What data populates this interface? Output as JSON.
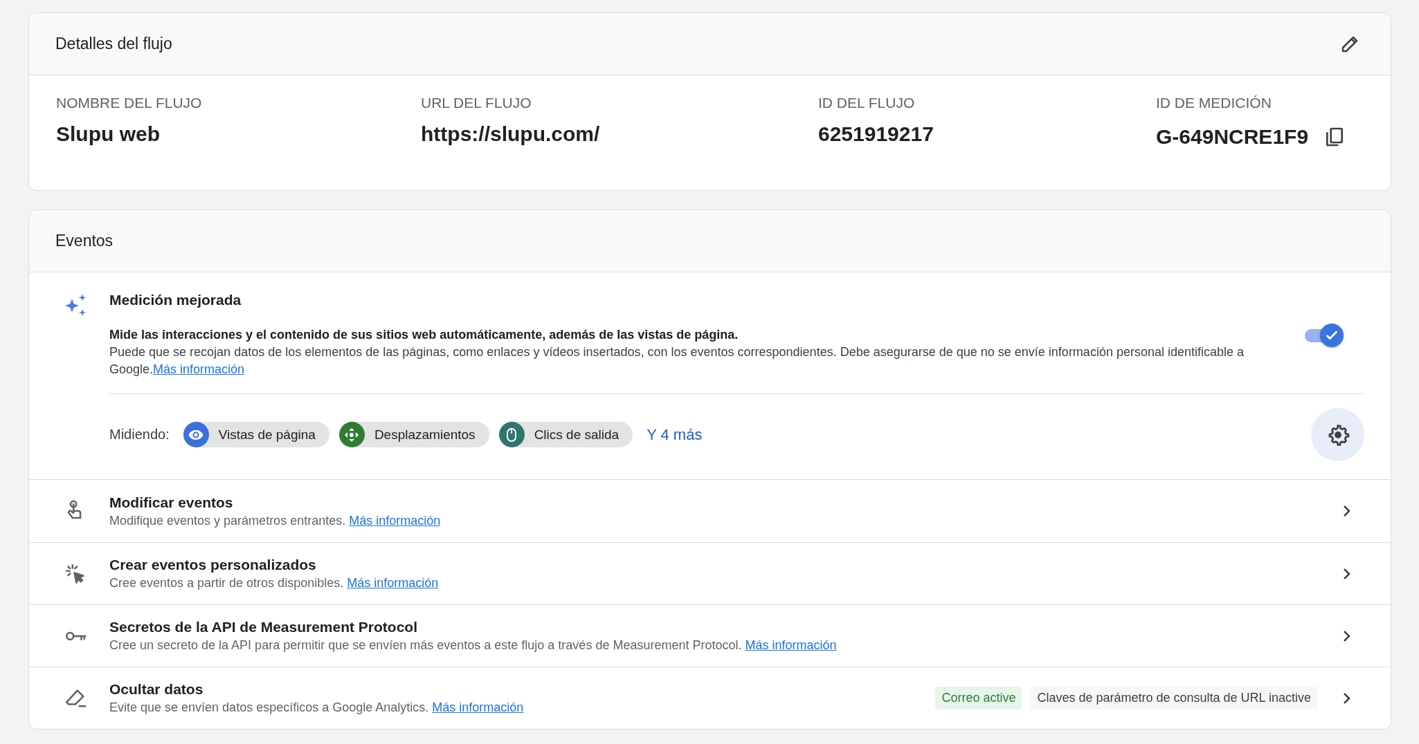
{
  "stream_details": {
    "title": "Detalles del flujo",
    "fields": [
      {
        "kind": "plain",
        "label": "NOMBRE DEL FLUJO",
        "value": "Slupu web"
      },
      {
        "kind": "plain",
        "label": "URL DEL FLUJO",
        "value": "https://slupu.com/"
      },
      {
        "kind": "plain",
        "label": "ID DEL FLUJO",
        "value": "6251919217"
      },
      {
        "kind": "copyable",
        "label": "ID DE MEDICIÓN",
        "value": "G-649NCRE1F9"
      }
    ]
  },
  "events": {
    "title": "Eventos",
    "enhanced": {
      "title": "Medición mejorada",
      "lead": "Mide las interacciones y el contenido de sus sitios web automáticamente, además de las vistas de página.",
      "description": "Puede que se recojan datos de los elementos de las páginas, como enlaces y vídeos insertados, con los eventos correspondientes. Debe asegurarse de que no se envíe información personal identificable a Google.",
      "link": "Más información",
      "enabled": true,
      "measuring_label": "Midiendo:",
      "chips": [
        {
          "kind": "pageviews",
          "label": "Vistas de página",
          "color": "#3b6fe0"
        },
        {
          "kind": "scrolls",
          "label": "Desplazamientos",
          "color": "#2e7d32"
        },
        {
          "kind": "outbound",
          "label": "Clics de salida",
          "color": "#2f7670"
        }
      ],
      "more": "Y 4 más"
    },
    "rows": [
      {
        "kind": "modify",
        "title": "Modificar eventos",
        "description": "Modifique eventos y parámetros entrantes.",
        "link": "Más información"
      },
      {
        "kind": "create",
        "title": "Crear eventos personalizados",
        "description": "Cree eventos a partir de otros disponibles.",
        "link": "Más información"
      },
      {
        "kind": "secret",
        "title": "Secretos de la API de Measurement Protocol",
        "description": "Cree un secreto de la API para permitir que se envíen más eventos a este flujo a través de Measurement Protocol.",
        "link": "Más información"
      },
      {
        "kind": "redact",
        "title": "Ocultar datos",
        "description": "Evite que se envíen datos específicos a Google Analytics.",
        "link": "Más información",
        "badges": [
          {
            "label": "Correo active",
            "active": true
          },
          {
            "label": "Claves de parámetro de consulta de URL inactive",
            "active": false
          }
        ]
      }
    ]
  }
}
